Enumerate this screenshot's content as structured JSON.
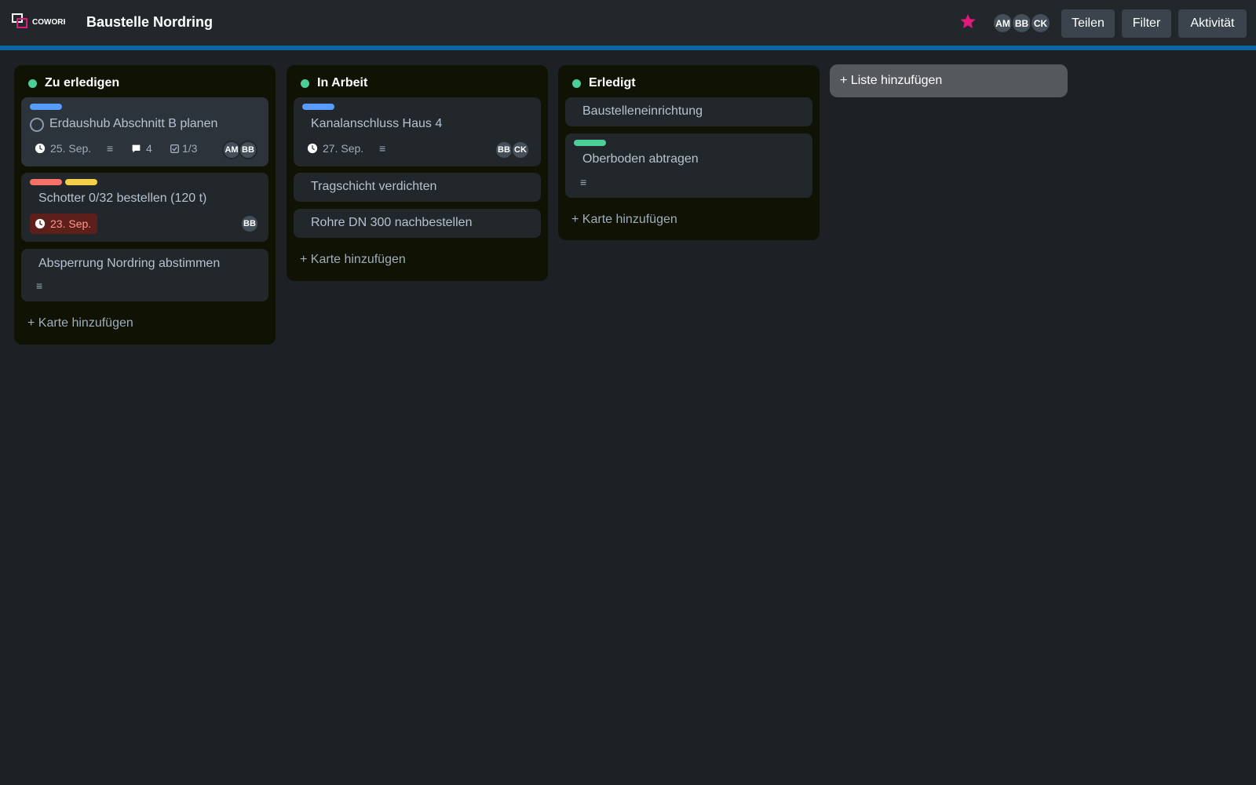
{
  "header": {
    "logo_text": "COWORK",
    "board_title": "Baustelle Nordring",
    "members": [
      "AM",
      "BB",
      "CK"
    ],
    "share_label": "Teilen",
    "filter_label": "Filter",
    "activity_label": "Aktivität"
  },
  "colors": {
    "accent_bar": "#0c66a4",
    "star": "#e2197c",
    "list_dot": "#4bce97",
    "label_blue": "#579dff",
    "label_red": "#f87168",
    "label_yellow": "#f5cd47",
    "label_green": "#4bce97"
  },
  "lists": [
    {
      "title": "Zu erledigen",
      "cards": [
        {
          "labels": [
            "blue"
          ],
          "title": "Erdaushub Abschnitt B planen",
          "due": "25. Sep.",
          "description_icon": "≡",
          "comments": "4",
          "checklist": "1/3",
          "members": [
            "AM",
            "BB"
          ]
        },
        {
          "labels": [
            "red",
            "yellow"
          ],
          "title": "Schotter 0/32 bestellen (120 t)",
          "due": "23. Sep.",
          "members": [
            "BB"
          ]
        },
        {
          "title": "Absperrung Nordring abstimmen",
          "description_icon": "≡"
        }
      ],
      "add_card_label": "+ Karte hinzufügen"
    },
    {
      "title": "In Arbeit",
      "cards": [
        {
          "labels": [
            "blue"
          ],
          "title": "Kanalanschluss Haus 4",
          "due": "27. Sep.",
          "description_icon": "≡",
          "members": [
            "BB",
            "CK"
          ]
        },
        {
          "title": "Tragschicht verdichten"
        },
        {
          "title": "Rohre DN 300 nachbestellen"
        }
      ],
      "add_card_label": "+ Karte hinzufügen"
    },
    {
      "title": "Erledigt",
      "cards": [
        {
          "title": "Baustelleneinrichtung"
        },
        {
          "labels": [
            "green"
          ],
          "title": "Oberboden abtragen",
          "description_icon": "≡"
        }
      ],
      "add_card_label": "+ Karte hinzufügen"
    }
  ],
  "add_list_label": "+ Liste hinzufügen"
}
